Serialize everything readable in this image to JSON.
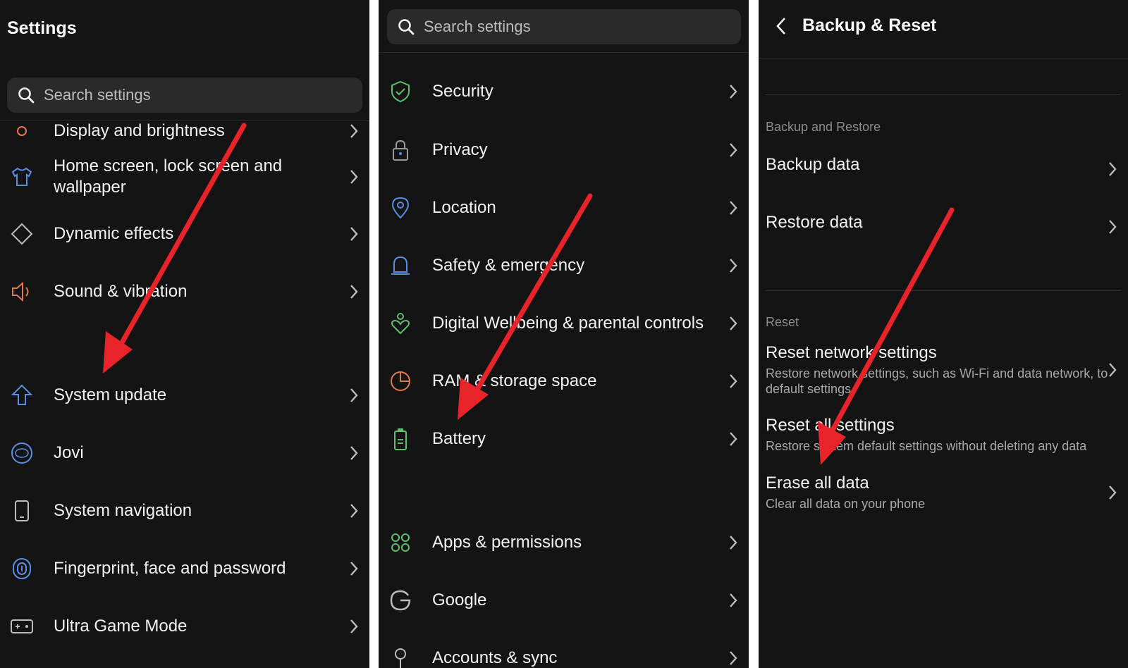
{
  "panel1": {
    "title": "Settings",
    "search_placeholder": "Search settings",
    "partial_item": "Display and brightness",
    "items": [
      {
        "label": "Home screen, lock screen and wallpaper",
        "icon": "shirt-icon",
        "color": "#5b8de0"
      },
      {
        "label": "Dynamic effects",
        "icon": "diamond-icon",
        "color": "#bdbdbd"
      },
      {
        "label": "Sound & vibration",
        "icon": "speaker-icon",
        "color": "#e07a4a"
      },
      {
        "label": "System update",
        "icon": "upload-arrow-icon",
        "color": "#5b8de0"
      },
      {
        "label": "Jovi",
        "icon": "jovi-icon",
        "color": "#5b8de0"
      },
      {
        "label": "System navigation",
        "icon": "phone-icon",
        "color": "#bdbdbd"
      },
      {
        "label": "Fingerprint, face and password",
        "icon": "fingerprint-icon",
        "color": "#5b8de0"
      },
      {
        "label": "Ultra Game Mode",
        "icon": "gamepad-icon",
        "color": "#bdbdbd"
      }
    ]
  },
  "panel2": {
    "search_placeholder": "Search settings",
    "items": [
      {
        "label": "Security",
        "icon": "shield-check-icon",
        "color": "#5fbf6f"
      },
      {
        "label": "Privacy",
        "icon": "lock-icon",
        "color": "#9a9a9a"
      },
      {
        "label": "Location",
        "icon": "location-pin-icon",
        "color": "#5b8de0"
      },
      {
        "label": "Safety & emergency",
        "icon": "bell-icon",
        "color": "#5b8de0"
      },
      {
        "label": "Digital Wellbeing & parental controls",
        "icon": "wellbeing-heart-icon",
        "color": "#5fbf6f"
      },
      {
        "label": "RAM & storage space",
        "icon": "pie-chart-icon",
        "color": "#e07a4a"
      },
      {
        "label": "Battery",
        "icon": "battery-icon",
        "color": "#5fbf6f"
      },
      {
        "label": "Apps & permissions",
        "icon": "apps-command-icon",
        "color": "#5fbf6f"
      },
      {
        "label": "Google",
        "icon": "google-icon",
        "color": "#bdbdbd"
      },
      {
        "label": "Accounts & sync",
        "icon": "key-icon",
        "color": "#bdbdbd"
      }
    ]
  },
  "panel3": {
    "title": "Backup & Reset",
    "section_backup": "Backup and Restore",
    "backup_data": "Backup data",
    "restore_data": "Restore data",
    "section_reset": "Reset",
    "reset_network_title": "Reset network settings",
    "reset_network_sub": "Restore network settings, such as Wi-Fi and data network, to default settings",
    "reset_all_title": "Reset all settings",
    "reset_all_sub": "Restore system default settings without deleting any data",
    "erase_title": "Erase all data",
    "erase_sub": "Clear all data on your phone"
  },
  "colors": {
    "background": "#141414",
    "search_bg": "#2a2a2a",
    "arrow": "#e8232a",
    "text": "#f2f2f2",
    "subtext": "#a8a8a8"
  }
}
